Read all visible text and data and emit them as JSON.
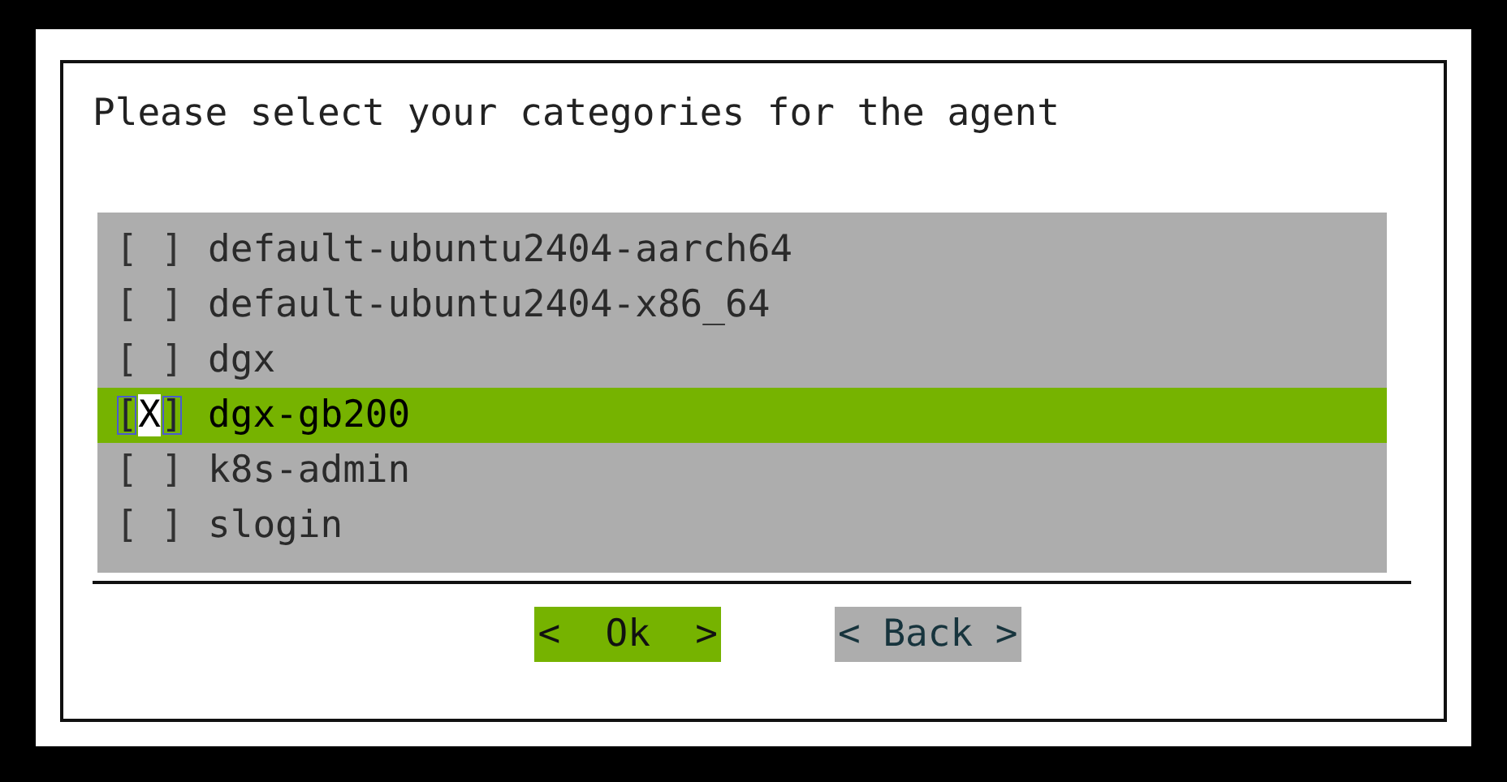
{
  "prompt": "Please select your categories for the agent",
  "checkbox": {
    "open": "[",
    "close": "]",
    "mark": "X"
  },
  "items": [
    {
      "label": "default-ubuntu2404-aarch64",
      "checked": false,
      "selected": false
    },
    {
      "label": "default-ubuntu2404-x86_64",
      "checked": false,
      "selected": false
    },
    {
      "label": "dgx",
      "checked": false,
      "selected": false
    },
    {
      "label": "dgx-gb200",
      "checked": true,
      "selected": true
    },
    {
      "label": "k8s-admin",
      "checked": false,
      "selected": false
    },
    {
      "label": "slogin",
      "checked": false,
      "selected": false
    }
  ],
  "buttons": [
    {
      "label": "<  Ok  >",
      "selected": true
    },
    {
      "label": "< Back >",
      "selected": false
    }
  ]
}
